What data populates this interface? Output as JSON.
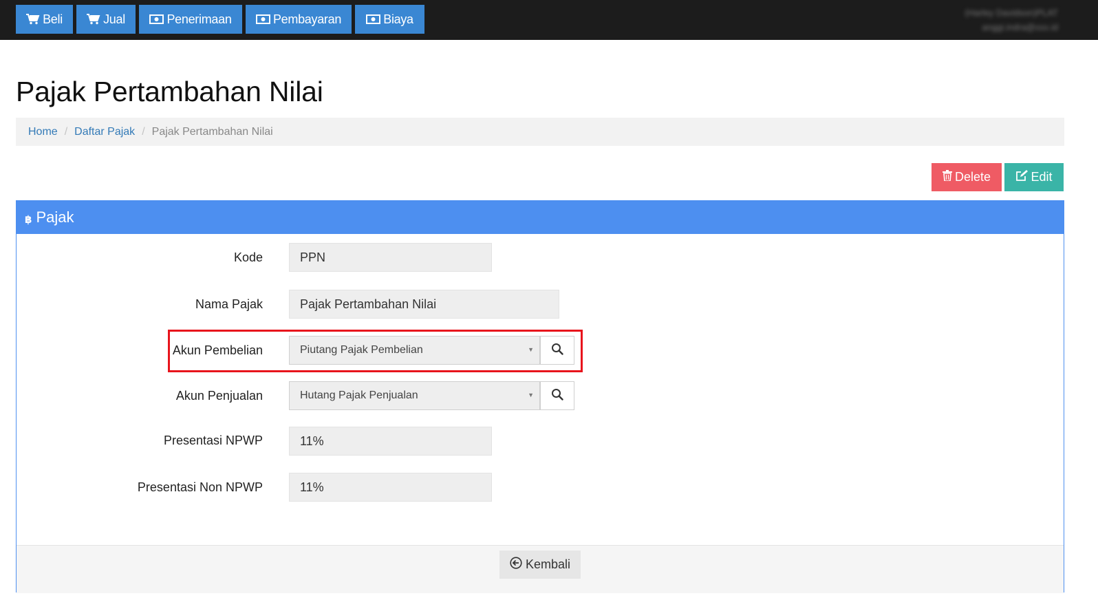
{
  "nav": {
    "buttons": [
      {
        "label": "Beli",
        "icon": "cart-icon"
      },
      {
        "label": "Jual",
        "icon": "cart-icon"
      },
      {
        "label": "Penerimaan",
        "icon": "money-icon"
      },
      {
        "label": "Pembayaran",
        "icon": "money-icon"
      },
      {
        "label": "Biaya",
        "icon": "money-icon"
      }
    ],
    "user_name": "(Harley Davidson)PLAT",
    "user_email": "anggi.indra@xxx.id"
  },
  "page": {
    "title": "Pajak Pertambahan Nilai"
  },
  "breadcrumb": {
    "items": [
      "Home",
      "Daftar Pajak",
      "Pajak Pertambahan Nilai"
    ]
  },
  "actions": {
    "delete_label": "Delete",
    "edit_label": "Edit"
  },
  "panel": {
    "title": "Pajak",
    "fields": {
      "kode": {
        "label": "Kode",
        "value": "PPN"
      },
      "nama": {
        "label": "Nama Pajak",
        "value": "Pajak Pertambahan Nilai"
      },
      "akun_pembelian": {
        "label": "Akun Pembelian",
        "value": "Piutang Pajak Pembelian"
      },
      "akun_penjualan": {
        "label": "Akun Penjualan",
        "value": "Hutang Pajak Penjualan"
      },
      "npwp": {
        "label": "Presentasi NPWP",
        "value": "11%"
      },
      "non_npwp": {
        "label": "Presentasi Non NPWP",
        "value": "11%"
      }
    },
    "back_label": "Kembali"
  },
  "colors": {
    "nav_button": "#3a87d3",
    "panel_header": "#4d8ff0",
    "delete": "#ef5b64",
    "edit": "#3ab4a7",
    "highlight": "#e8141c"
  }
}
